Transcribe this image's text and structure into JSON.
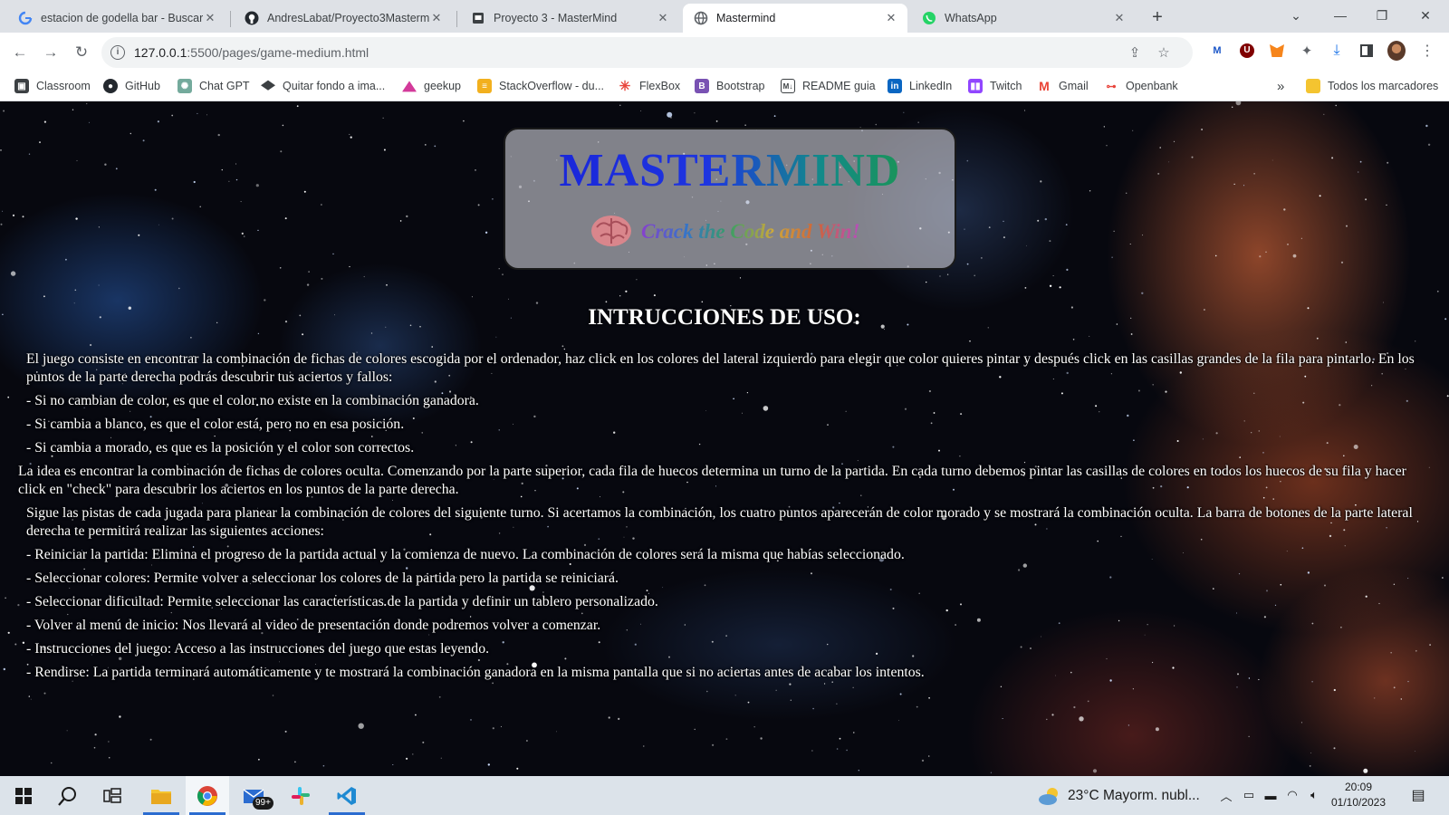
{
  "browser": {
    "tabs": [
      {
        "title": "estacion de godella bar - Buscar",
        "favicon": "google-icon",
        "active": false
      },
      {
        "title": "AndresLabat/Proyecto3Mastermind",
        "favicon": "github-icon",
        "active": false
      },
      {
        "title": "Proyecto 3 - MasterMind",
        "favicon": "document-icon",
        "active": false
      },
      {
        "title": "Mastermind",
        "favicon": "globe-icon",
        "active": true
      },
      {
        "title": "WhatsApp",
        "favicon": "whatsapp-icon",
        "active": false
      }
    ],
    "new_tab": "+",
    "address": {
      "host": "127.0.0.1",
      "path": ":5500/pages/game-medium.html"
    },
    "bookmarks": [
      {
        "label": "Classroom",
        "icon": "classroom-icon",
        "color": "#3c4043"
      },
      {
        "label": "GitHub",
        "icon": "github-icon",
        "color": "#24292f"
      },
      {
        "label": "Chat GPT",
        "icon": "chatgpt-icon",
        "color": "#74aa9c"
      },
      {
        "label": "Quitar fondo a ima...",
        "icon": "removebg-icon",
        "color": "#3c4043"
      },
      {
        "label": "geekup",
        "icon": "geekup-icon",
        "color": "#d33a9a"
      },
      {
        "label": "StackOverflow - du...",
        "icon": "stackoverflow-icon",
        "color": "#f2b01e"
      },
      {
        "label": "FlexBox",
        "icon": "flexbox-icon",
        "color": "#e8453c"
      },
      {
        "label": "Bootstrap",
        "icon": "bootstrap-icon",
        "color": "#7952b3"
      },
      {
        "label": "README guia",
        "icon": "readme-icon",
        "color": "#3c4043"
      },
      {
        "label": "LinkedIn",
        "icon": "linkedin-icon",
        "color": "#0a66c2"
      },
      {
        "label": "Twitch",
        "icon": "twitch-icon",
        "color": "#9146ff"
      },
      {
        "label": "Gmail",
        "icon": "gmail-icon",
        "color": "#ea4335"
      },
      {
        "label": "Openbank",
        "icon": "openbank-icon",
        "color": "#e8453c"
      }
    ],
    "bookmarks_overflow": "»",
    "all_bookmarks": "Todos los marcadores"
  },
  "page": {
    "logo_title": "MASTERMIND",
    "logo_subtitle": "Crack the Code and Win!",
    "instructions_title": "INTRUCCIONES DE USO:",
    "instructions": {
      "intro": "El juego consiste en encontrar la combinación de fichas de colores escogida por el ordenador, haz click en los colores del lateral izquierdo para elegir que color quieres pintar y después click en las casillas grandes de la fila para pintarlo. En los puntos de la parte derecha podrás descubrir tus aciertos y fallos:",
      "hints": [
        "- Si no cambian de color, es que el color no existe en la combinación ganadora.",
        "- Si cambia a blanco, es que el color está, pero no en esa posición.",
        "- Si cambia a morado, es que es la posición y el color son correctos."
      ],
      "idea": "La idea es encontrar la combinación de fichas de colores oculta. Comenzando por la parte superior, cada fila de huecos determina un turno de la partida. En cada turno debemos pintar las casillas de colores en todos los huecos de su fila y hacer click en \"check\" para descubrir los aciertos en los puntos de la parte derecha.",
      "follow": "Sigue las pistas de cada jugada para planear la combinación de colores del siguiente turno. Si acertamos la combinación, los cuatro puntos aparecerán de color morado y se mostrará la combinación oculta. La barra de botones de la parte lateral derecha te permitirá realizar las siguientes acciones:",
      "actions": [
        "- Reiniciar la partida: Elimina el progreso de la partida actual y la comienza de nuevo. La combinación de colores será la misma que habías seleccionado.",
        "- Seleccionar colores: Permite volver a seleccionar los colores de la partida pero la partida se reiniciará.",
        "- Seleccionar dificultad: Permite seleccionar las características de la partida y definir un tablero personalizado.",
        "- Volver al menú de inicio: Nos llevará al video de presentación donde podremos volver a comenzar.",
        "- Instrucciones del juego: Acceso a las instrucciones del juego que estas leyendo.",
        "- Rendirse: La partida terminará automáticamente y te mostrará la combinación ganadora en la misma pantalla que si no aciertas antes de acabar los intentos."
      ]
    }
  },
  "taskbar": {
    "apps": [
      "start-icon",
      "search-icon",
      "task-view-icon",
      "file-explorer-icon",
      "chrome-icon",
      "mail-icon",
      "slack-icon",
      "vscode-icon"
    ],
    "mail_badge": "99+",
    "weather": "23°C  Mayorm. nubl...",
    "time": "20:09",
    "date": "01/10/2023"
  }
}
